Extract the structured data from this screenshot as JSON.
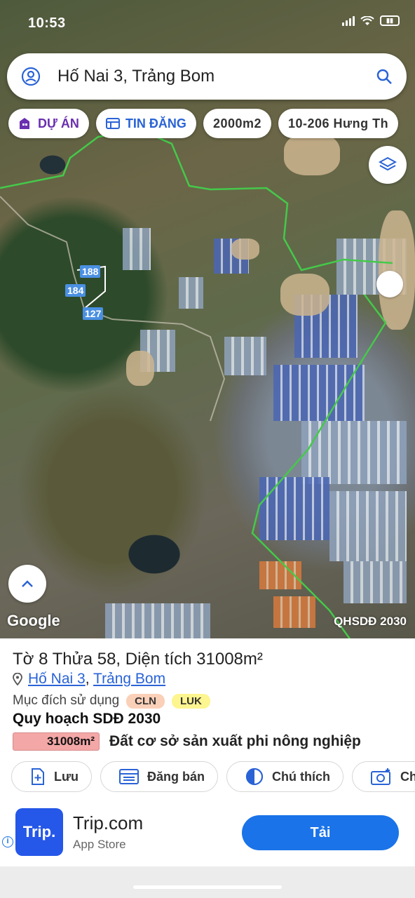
{
  "status": {
    "time": "10:53"
  },
  "search": {
    "query": "Hố Nai 3, Trảng Bom"
  },
  "filters": [
    {
      "label": "DỰ ÁN"
    },
    {
      "label": "TIN ĐĂNG"
    },
    {
      "label": "2000m2"
    },
    {
      "label": "10-206 Hưng Th"
    }
  ],
  "map": {
    "parcels": [
      "188",
      "184",
      "127"
    ],
    "logo": "Google",
    "source": "QHSDĐ 2030"
  },
  "parcel": {
    "title": "Tờ 8 Thửa 58, Diện tích 31008m²",
    "ward": "Hố Nai 3",
    "separator": ",",
    "district": "Trảng Bom",
    "purpose_label": "Mục đích sử dụng",
    "purpose_tags": [
      "CLN",
      "LUK"
    ],
    "plan_heading": "Quy hoạch SDĐ 2030",
    "plan_area": "31008m²",
    "plan_desc": "Đất cơ sở sản xuất phi nông nghiệp"
  },
  "actions": [
    {
      "label": "Lưu",
      "icon": "bookmark-plus-icon"
    },
    {
      "label": "Đăng bán",
      "icon": "listing-icon"
    },
    {
      "label": "Chú thích",
      "icon": "half-circle-icon"
    },
    {
      "label": "Ch",
      "icon": "camera-icon"
    }
  ],
  "ad": {
    "logo_text": "Trip.",
    "name": "Trip.com",
    "store": "App Store",
    "install_label": "Tải"
  },
  "colors": {
    "accent": "#1a73e8",
    "purple": "#6a2fb0",
    "plan_red": "#f4a7a7"
  }
}
